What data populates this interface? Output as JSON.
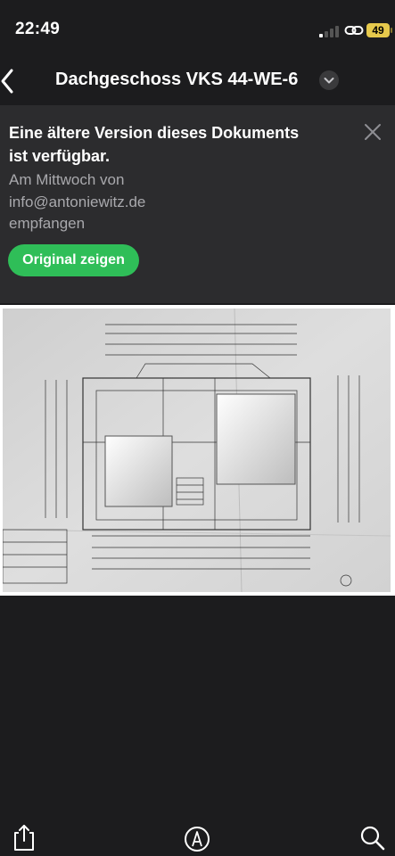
{
  "status_bar": {
    "time": "22:49",
    "battery": "49",
    "icons": [
      "signal-icon",
      "link-icon",
      "battery-icon"
    ]
  },
  "nav": {
    "title": "Dachgeschoss VKS 44-WE-6",
    "back_icon": "chevron-left-icon",
    "menu_icon": "chevron-down-circle-icon"
  },
  "banner": {
    "title": "Eine ältere Version dieses Dokuments ist verfügbar.",
    "subtitle": "Am Mittwoch von info@antoniewitz.de empfangen",
    "button_label": "Original zeigen",
    "close_icon": "close-icon"
  },
  "document": {
    "image": "floor-plan-scan"
  },
  "toolbar": {
    "icons": [
      "share-icon",
      "markup-icon",
      "search-icon"
    ]
  },
  "colors": {
    "background": "#1c1c1e",
    "banner": "#2c2c2e",
    "accent_green": "#2fbe58",
    "battery": "#e6c94c"
  }
}
